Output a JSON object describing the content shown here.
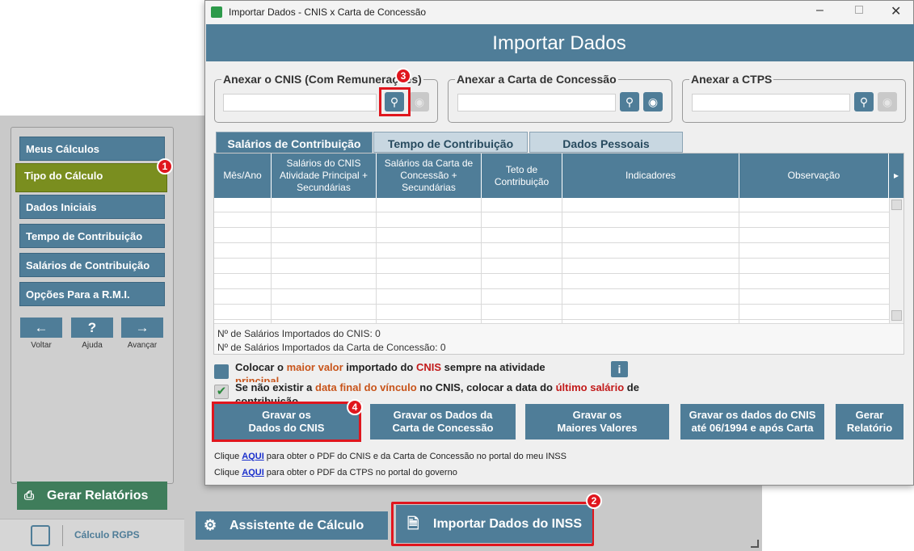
{
  "sidebar": {
    "items": [
      {
        "label": "Meus Cálculos"
      },
      {
        "label": "Tipo do Cálculo"
      },
      {
        "label": "Dados Iniciais"
      },
      {
        "label": "Tempo de Contribuição"
      },
      {
        "label": "Salários de Contribuição"
      },
      {
        "label": "Opções Para a R.M.I."
      }
    ],
    "back_label": "Voltar",
    "help_label": "Ajuda",
    "forward_label": "Avançar",
    "reports_button": "Gerar Relatórios",
    "app_name": "Cálculo RGPS"
  },
  "bottom": {
    "assistant_button": "Assistente de Cálculo",
    "import_button": "Importar Dados do INSS"
  },
  "dialog": {
    "window_title": "Importar Dados - CNIS x Carta de Concessão",
    "header": "Importar Dados",
    "groups": [
      {
        "label": "Anexar o CNIS (Com Remunerações)",
        "value": ""
      },
      {
        "label": "Anexar a Carta de Concessão",
        "value": ""
      },
      {
        "label": "Anexar a CTPS",
        "value": ""
      }
    ],
    "tabs": [
      "Salários de Contribuição",
      "Tempo de Contribuição",
      "Dados Pessoais"
    ],
    "columns": [
      "Mês/Ano",
      "Salários do CNIS Atividade Principal + Secundárias",
      "Salários da Carta de Concessão + Secundárias",
      "Teto de Contribuição",
      "Indicadores",
      "Observação"
    ],
    "footer_cnis": "Nº de Salários Importados do CNIS: 0",
    "footer_carta": "Nº de Salários Importados da Carta de Concessão: 0",
    "option1": {
      "a": "Colocar o ",
      "b": "maior valor",
      "c": " importado do ",
      "d": "CNIS",
      "e": " sempre na atividade",
      "f": "principal",
      "checked": false
    },
    "option2": {
      "a": "Se não existir a ",
      "b": "data final do vínculo",
      "c": " no CNIS, colocar a data do ",
      "d": "último salário",
      "e": " de",
      "f": "contribuição",
      "checked": true
    },
    "info_icon_label": "i",
    "buttons": [
      {
        "line1": "Gravar os",
        "line2": "Dados do CNIS"
      },
      {
        "line1": "Gravar os Dados da",
        "line2": "Carta de Concessão"
      },
      {
        "line1": "Gravar os",
        "line2": "Maiores Valores"
      },
      {
        "line1": "Gravar os dados do CNIS",
        "line2": "até 06/1994 e após Carta"
      },
      {
        "line1": "Gerar",
        "line2": "Relatório"
      }
    ],
    "link1": {
      "pre": "Clique ",
      "link": "AQUI",
      "post": " para obter o PDF do CNIS e da Carta de Concessão no portal do meu INSS"
    },
    "link2": {
      "pre": "Clique ",
      "link": "AQUI",
      "post": " para obter o PDF da CTPS no portal do governo"
    }
  },
  "badges": [
    "1",
    "2",
    "3",
    "4"
  ],
  "colors": {
    "primary": "#4f7d98",
    "active": "#7a8e1f",
    "highlight": "#e0161e",
    "green_button": "#3f7d5b"
  }
}
